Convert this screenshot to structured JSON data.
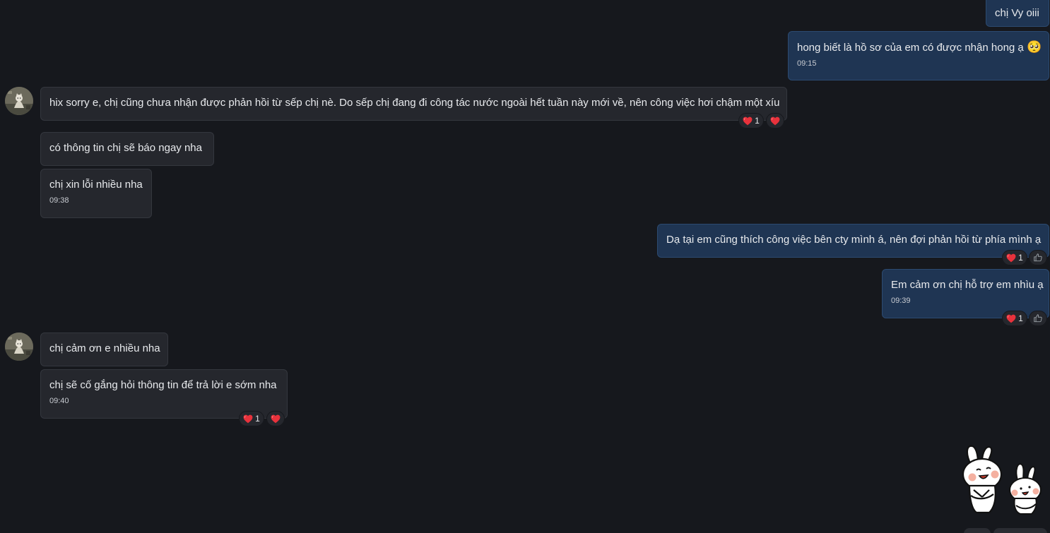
{
  "messages": [
    {
      "id": "m1",
      "text": "chị Vy oiii"
    },
    {
      "id": "m2",
      "text": "hong biết là hồ sơ của em có được nhận hong ạ",
      "emoji": "🥺",
      "time": "09:15"
    },
    {
      "id": "m3",
      "text": "hix sorry e, chị cũng chưa nhận được phản hồi từ sếp chị nè. Do sếp chị đang đi công tác nước ngoài hết tuần này mới về, nên công việc hơi chậm một xíu",
      "reaction_count": "1"
    },
    {
      "id": "m4",
      "text": "có thông tin chị sẽ báo ngay nha"
    },
    {
      "id": "m5",
      "text": "chị xin lỗi nhiều nha",
      "time": "09:38"
    },
    {
      "id": "m6",
      "text": "Dạ tại em cũng thích công việc bên cty mình á, nên đợi phản hồi từ phía mình ạ",
      "reaction_count": "1"
    },
    {
      "id": "m7",
      "text": "Em cảm ơn chị hỗ trợ em nhìu ạ",
      "time": "09:39",
      "reaction_count": "1"
    },
    {
      "id": "m8",
      "text": "chị cảm ơn e nhiều nha"
    },
    {
      "id": "m9",
      "text": "chị sẽ cố gắng hỏi thông tin để trả lời e sớm nha",
      "time": "09:40",
      "reaction_count": "1"
    }
  ],
  "icons": {
    "reaction": "heart-icon",
    "add_reaction": "thumbs-up-icon",
    "avatar": "contact-avatar",
    "sticker": "bunny-sticker"
  },
  "colors": {
    "background": "#16181d",
    "incoming_bubble": "#25272d",
    "outgoing_bubble": "#1f3553",
    "heart": "#e8323c"
  }
}
